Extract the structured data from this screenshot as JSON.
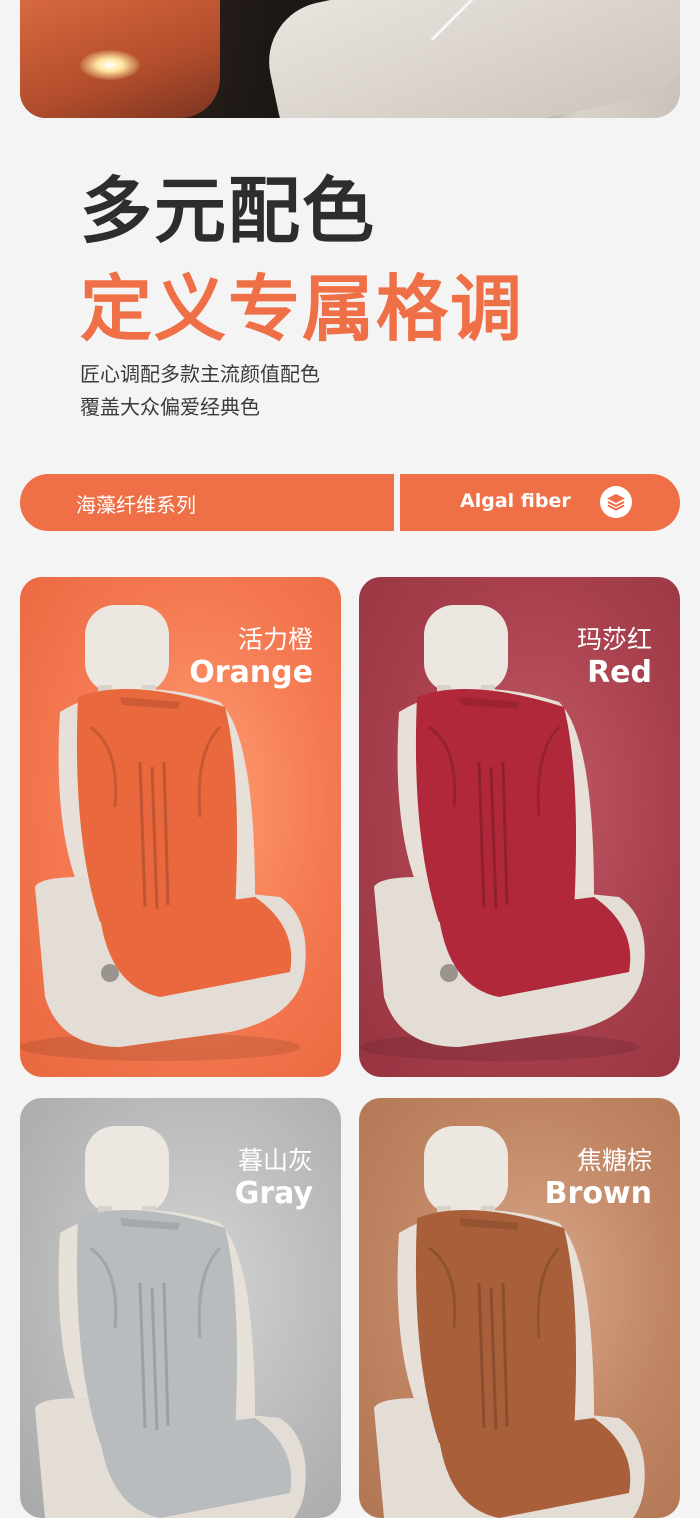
{
  "title_line1": "多元配色",
  "title_line2": "定义专属格调",
  "description": [
    "匠心调配多款主流颜值配色",
    "覆盖大众偏爱经典色"
  ],
  "series_bar": {
    "cn": "海藻纤维系列",
    "en": "Algal fiber",
    "icon": "layers-icon"
  },
  "colors": [
    {
      "cn": "活力橙",
      "en": "Orange",
      "pad_color": "#e9683e"
    },
    {
      "cn": "玛莎红",
      "en": "Red",
      "pad_color": "#b1283a"
    },
    {
      "cn": "暮山灰",
      "en": "Gray",
      "pad_color": "#b9bcbf"
    },
    {
      "cn": "焦糖棕",
      "en": "Brown",
      "pad_color": "#a9603a"
    }
  ],
  "accent": "#ef6f46"
}
